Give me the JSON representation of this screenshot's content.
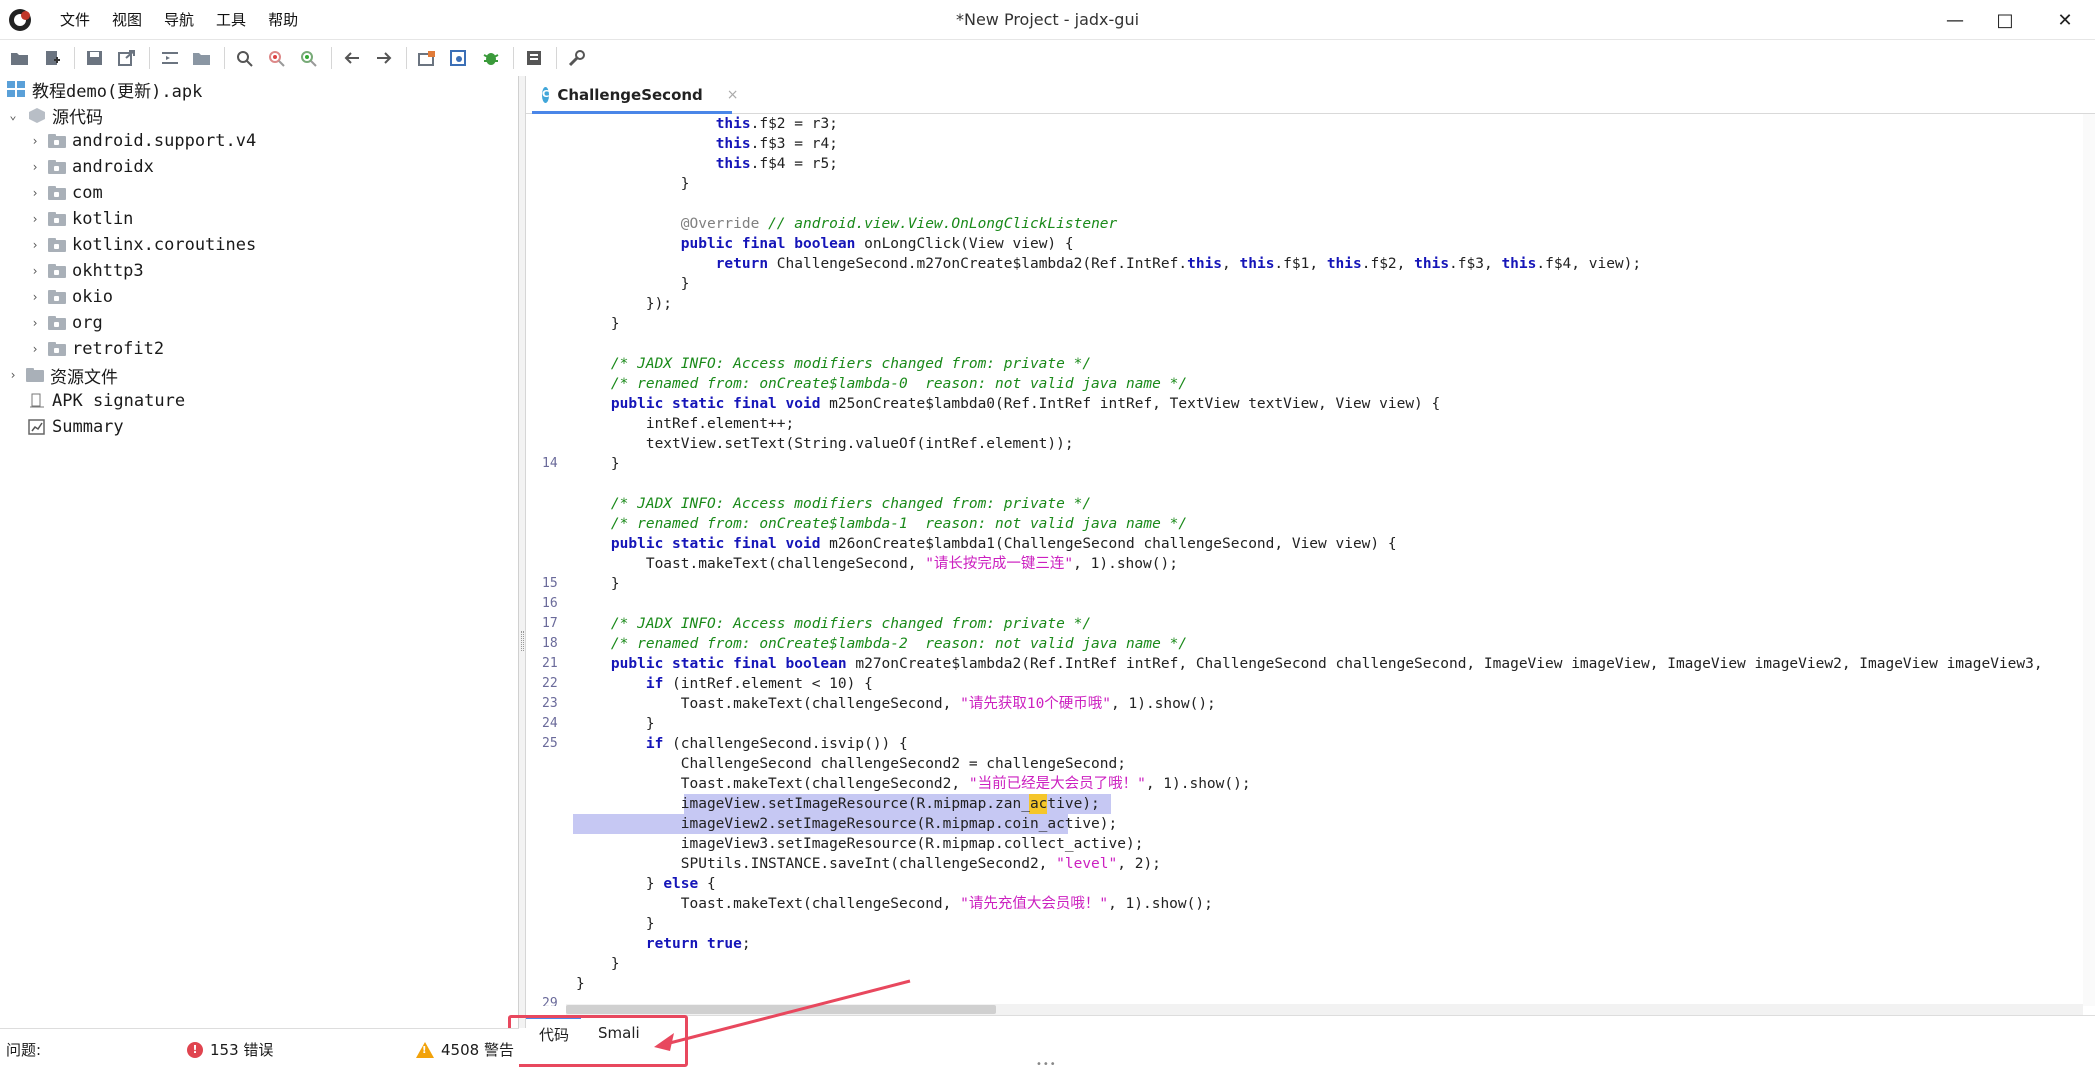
{
  "window": {
    "title": "*New Project - jadx-gui",
    "minimize": "—",
    "maximize": "□",
    "close": "✕"
  },
  "menu": [
    "文件",
    "视图",
    "导航",
    "工具",
    "帮助"
  ],
  "toolbar": {
    "icons": [
      "open-icon",
      "add-file-icon",
      "save-icon",
      "export-icon",
      "sync-icon",
      "flat-packages-icon",
      "search-icon",
      "find-class-icon",
      "usage-search-icon",
      "back-icon",
      "forward-icon",
      "deobfuscation-icon",
      "quark-icon",
      "debug-icon",
      "log-icon",
      "preferences-icon"
    ]
  },
  "tree": {
    "root": "教程demo(更新).apk",
    "source_label": "源代码",
    "packages": [
      "android.support.v4",
      "androidx",
      "com",
      "kotlin",
      "kotlinx.coroutines",
      "okhttp3",
      "okio",
      "org",
      "retrofit2"
    ],
    "resources_label": "资源文件",
    "apk_signature": "APK signature",
    "summary": "Summary"
  },
  "editor": {
    "tab_label": "ChallengeSecond",
    "tab_close": "×",
    "accent_color": "#4a86e8",
    "line_numbers": [
      {
        "row": 17,
        "value": "14"
      },
      {
        "row": 23,
        "value": "15"
      },
      {
        "row": 24,
        "value": "16"
      },
      {
        "row": 25,
        "value": "17"
      },
      {
        "row": 26,
        "value": "18"
      },
      {
        "row": 27,
        "value": "21"
      },
      {
        "row": 28,
        "value": "22"
      },
      {
        "row": 29,
        "value": "23"
      },
      {
        "row": 30,
        "value": "24"
      },
      {
        "row": 31,
        "value": "25"
      },
      {
        "row": 44,
        "value": "29"
      }
    ],
    "code_lines": [
      [
        [
          "plain",
          "                "
        ],
        [
          "kw",
          "this"
        ],
        [
          "plain",
          ".f$2 = r3;"
        ]
      ],
      [
        [
          "plain",
          "                "
        ],
        [
          "kw",
          "this"
        ],
        [
          "plain",
          ".f$3 = r4;"
        ]
      ],
      [
        [
          "plain",
          "                "
        ],
        [
          "kw",
          "this"
        ],
        [
          "plain",
          ".f$4 = r5;"
        ]
      ],
      [
        [
          "plain",
          "            }"
        ]
      ],
      [
        [
          "plain",
          ""
        ]
      ],
      [
        [
          "ann",
          "            @Override "
        ],
        [
          "cmt",
          "// android.view.View.OnLongClickListener"
        ]
      ],
      [
        [
          "plain",
          "            "
        ],
        [
          "kw",
          "public final boolean"
        ],
        [
          "plain",
          " onLongClick(View view) {"
        ]
      ],
      [
        [
          "plain",
          "                "
        ],
        [
          "kw",
          "return"
        ],
        [
          "plain",
          " ChallengeSecond.m27onCreate$lambda2(Ref.IntRef."
        ],
        [
          "kw",
          "this"
        ],
        [
          "plain",
          ", "
        ],
        [
          "kw",
          "this"
        ],
        [
          "plain",
          ".f$1, "
        ],
        [
          "kw",
          "this"
        ],
        [
          "plain",
          ".f$2, "
        ],
        [
          "kw",
          "this"
        ],
        [
          "plain",
          ".f$3, "
        ],
        [
          "kw",
          "this"
        ],
        [
          "plain",
          ".f$4, view);"
        ]
      ],
      [
        [
          "plain",
          "            }"
        ]
      ],
      [
        [
          "plain",
          "        });"
        ]
      ],
      [
        [
          "plain",
          "    }"
        ]
      ],
      [
        [
          "plain",
          ""
        ]
      ],
      [
        [
          "cmt",
          "    /* JADX INFO: Access modifiers changed from: private */"
        ]
      ],
      [
        [
          "cmt",
          "    /* renamed from: onCreate$lambda-0  reason: not valid java name */"
        ]
      ],
      [
        [
          "plain",
          "    "
        ],
        [
          "kw",
          "public static final void"
        ],
        [
          "plain",
          " m25onCreate$lambda0(Ref.IntRef intRef, TextView textView, View view) {"
        ]
      ],
      [
        [
          "plain",
          "        intRef.element++;"
        ]
      ],
      [
        [
          "plain",
          "        textView.setText(String.valueOf(intRef.element));"
        ]
      ],
      [
        [
          "plain",
          "    }"
        ]
      ],
      [
        [
          "plain",
          ""
        ]
      ],
      [
        [
          "cmt",
          "    /* JADX INFO: Access modifiers changed from: private */"
        ]
      ],
      [
        [
          "cmt",
          "    /* renamed from: onCreate$lambda-1  reason: not valid java name */"
        ]
      ],
      [
        [
          "plain",
          "    "
        ],
        [
          "kw",
          "public static final void"
        ],
        [
          "plain",
          " m26onCreate$lambda1(ChallengeSecond challengeSecond, View view) {"
        ]
      ],
      [
        [
          "plain",
          "        Toast.makeText(challengeSecond, "
        ],
        [
          "str",
          "\"请长按完成一键三连\""
        ],
        [
          "plain",
          ", 1).show();"
        ]
      ],
      [
        [
          "plain",
          "    }"
        ]
      ],
      [
        [
          "plain",
          ""
        ]
      ],
      [
        [
          "cmt",
          "    /* JADX INFO: Access modifiers changed from: private */"
        ]
      ],
      [
        [
          "cmt",
          "    /* renamed from: onCreate$lambda-2  reason: not valid java name */"
        ]
      ],
      [
        [
          "plain",
          "    "
        ],
        [
          "kw",
          "public static final boolean"
        ],
        [
          "plain",
          " m27onCreate$lambda2(Ref.IntRef intRef, ChallengeSecond challengeSecond, ImageView imageView, ImageView imageView2, ImageView imageView3,"
        ]
      ],
      [
        [
          "plain",
          "        "
        ],
        [
          "kw",
          "if"
        ],
        [
          "plain",
          " (intRef.element < 10) {"
        ]
      ],
      [
        [
          "plain",
          "            Toast.makeText(challengeSecond, "
        ],
        [
          "str",
          "\"请先获取10个硬币哦\""
        ],
        [
          "plain",
          ", 1).show();"
        ]
      ],
      [
        [
          "plain",
          "        }"
        ]
      ],
      [
        [
          "plain",
          "        "
        ],
        [
          "kw",
          "if"
        ],
        [
          "plain",
          " (challengeSecond.isvip()) {"
        ]
      ],
      [
        [
          "plain",
          "            ChallengeSecond challengeSecond2 = challengeSecond;"
        ]
      ],
      [
        [
          "plain",
          "            Toast.makeText(challengeSecond2, "
        ],
        [
          "str",
          "\"当前已经是大会员了哦！\""
        ],
        [
          "plain",
          ", 1).show();"
        ]
      ],
      [
        [
          "plain",
          "            imageView.setImageResource(R.mipmap.zan_active);"
        ]
      ],
      [
        [
          "plain",
          "            imageView2.setImageResource(R.mipmap.coin_active);"
        ]
      ],
      [
        [
          "plain",
          "            imageView3.setImageResource(R.mipmap.collect_active);"
        ]
      ],
      [
        [
          "plain",
          "            SPUtils.INSTANCE.saveInt(challengeSecond2, "
        ],
        [
          "str",
          "\"level\""
        ],
        [
          "plain",
          ", 2);"
        ]
      ],
      [
        [
          "plain",
          "        } "
        ],
        [
          "kw",
          "else"
        ],
        [
          "plain",
          " {"
        ]
      ],
      [
        [
          "plain",
          "            Toast.makeText(challengeSecond, "
        ],
        [
          "str",
          "\"请先充值大会员哦！\""
        ],
        [
          "plain",
          ", 1).show();"
        ]
      ],
      [
        [
          "plain",
          "        }"
        ]
      ],
      [
        [
          "plain",
          "        "
        ],
        [
          "kw",
          "return true"
        ],
        [
          "plain",
          ";"
        ]
      ],
      [
        [
          "plain",
          "    }"
        ]
      ],
      [
        [
          "plain",
          "}"
        ]
      ]
    ]
  },
  "bottom_tabs": {
    "code": "代码",
    "smali": "Smali"
  },
  "status": {
    "problems_label": "问题:",
    "errors": "153 错误",
    "warnings": "4508 警告",
    "error_color": "#e0444f",
    "warning_color": "#f2a20a"
  }
}
